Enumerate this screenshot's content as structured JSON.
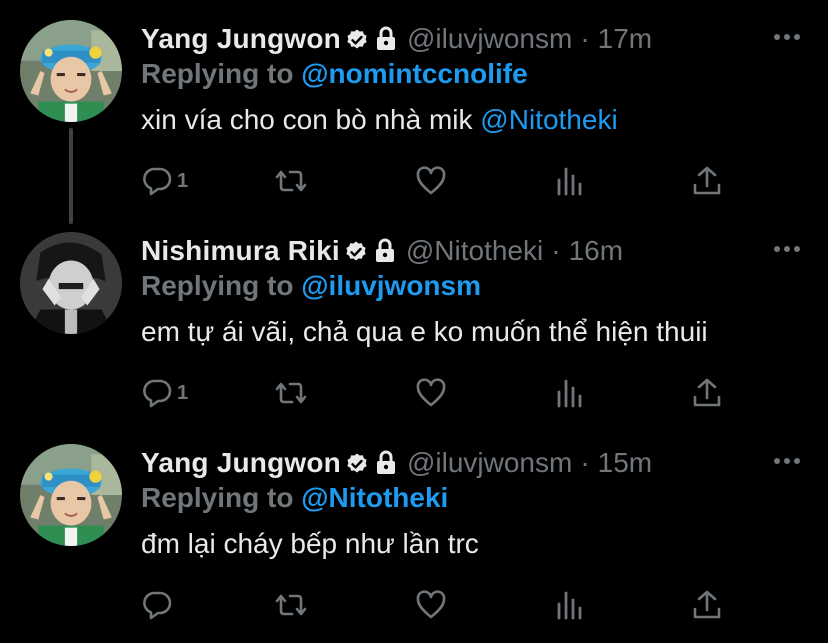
{
  "tweets": [
    {
      "name": "Yang Jungwon",
      "handle": "@iluvjwonsm",
      "separator": "·",
      "time": "17m",
      "replying_prefix": "Replying to ",
      "replying_to": "@nomintccnolife",
      "text": "xin vía cho con bò nhà mik ",
      "text_mention": "@Nitotheki",
      "reply_count": "1",
      "avatar": "jungwon-avatar"
    },
    {
      "name": "Nishimura Riki",
      "handle": "@Nitotheki",
      "separator": "·",
      "time": "16m",
      "replying_prefix": "Replying to ",
      "replying_to": "@iluvjwonsm",
      "text": "em tự ái vãi, chả qua e ko muốn thể hiện thuii",
      "text_mention": "",
      "reply_count": "1",
      "avatar": "riki-avatar"
    },
    {
      "name": "Yang Jungwon",
      "handle": "@iluvjwonsm",
      "separator": "·",
      "time": "15m",
      "replying_prefix": "Replying to ",
      "replying_to": "@Nitotheki",
      "text": "đm lại cháy bếp như lần trc",
      "text_mention": "",
      "reply_count": "",
      "avatar": "jungwon-avatar"
    }
  ],
  "colors": {
    "background": "#000000",
    "primary_text": "#e7e9ea",
    "secondary_text": "#71767b",
    "link": "#1d9bf0",
    "thread_line": "#3e4144"
  },
  "icons": {
    "verified": "verified-badge-icon",
    "protected": "lock-icon",
    "more": "more-icon",
    "reply": "reply-icon",
    "retweet": "retweet-icon",
    "like": "heart-icon",
    "analytics": "analytics-icon",
    "share": "share-icon"
  }
}
